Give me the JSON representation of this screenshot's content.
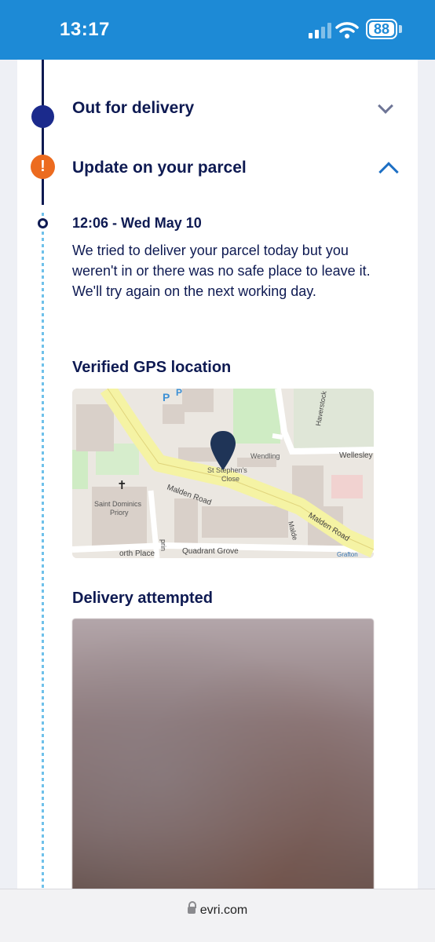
{
  "status_bar": {
    "time": "13:17",
    "battery": "88"
  },
  "timeline": {
    "previous_event": "Out for delivery",
    "section": {
      "title": "Update on your parcel",
      "event_time": "12:06 - Wed May 10",
      "event_description": "We tried to deliver your parcel today but you weren't in or there was no safe place to leave it. We'll try again on the next working day."
    }
  },
  "gps": {
    "title": "Verified GPS location",
    "map_labels": {
      "road1": "Malden Road",
      "road2": "Malden Road",
      "priory": "Saint Dominics",
      "priory2": "Priory",
      "wendling": "Wendling",
      "st_stephens": "St Stephen's",
      "close": "Close",
      "wellesley": "Wellesley",
      "haverstock": "Haverstock",
      "north_place": "orth Place",
      "quadrant": "Quadrant Grove",
      "malden_small": "Malde",
      "grafton": "Grafton",
      "prince": "prin"
    }
  },
  "delivery_attempted": {
    "title": "Delivery attempted"
  },
  "browser": {
    "url": "evri.com"
  },
  "colors": {
    "brand_blue": "#1d8ad6",
    "navy": "#0e1a52",
    "alert_orange": "#ec6b1f"
  }
}
